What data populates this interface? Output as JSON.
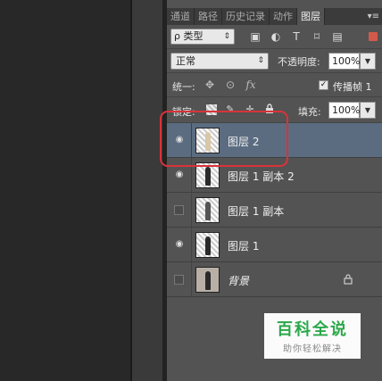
{
  "tabs": [
    {
      "label": "通道",
      "active": false
    },
    {
      "label": "路径",
      "active": false
    },
    {
      "label": "历史记录",
      "active": false
    },
    {
      "label": "动作",
      "active": false
    },
    {
      "label": "图层",
      "active": true
    }
  ],
  "filter": {
    "kind_label": "ρ 类型"
  },
  "blend": {
    "mode": "正常",
    "opacity_label": "不透明度:",
    "opacity_value": "100%"
  },
  "unify": {
    "label": "统一:",
    "propagate_label": "传播帧 1",
    "propagate_checked": true
  },
  "lock": {
    "label": "锁定:",
    "fill_label": "填充:",
    "fill_value": "100%"
  },
  "layers": [
    {
      "name": "图层 2",
      "visible": true,
      "selected": true
    },
    {
      "name": "图层 1 副本 2",
      "visible": true,
      "selected": false
    },
    {
      "name": "图层 1 副本",
      "visible": false,
      "selected": false
    },
    {
      "name": "图层 1",
      "visible": true,
      "selected": false
    },
    {
      "name": "背景",
      "visible": false,
      "selected": false,
      "locked": true
    }
  ],
  "watermark": {
    "title": "百科全说",
    "subtitle": "助你轻松解决"
  },
  "colors": {
    "selected_row": "#5b6c80",
    "annotation": "#d8333a",
    "watermark_green": "#2aa84a"
  }
}
